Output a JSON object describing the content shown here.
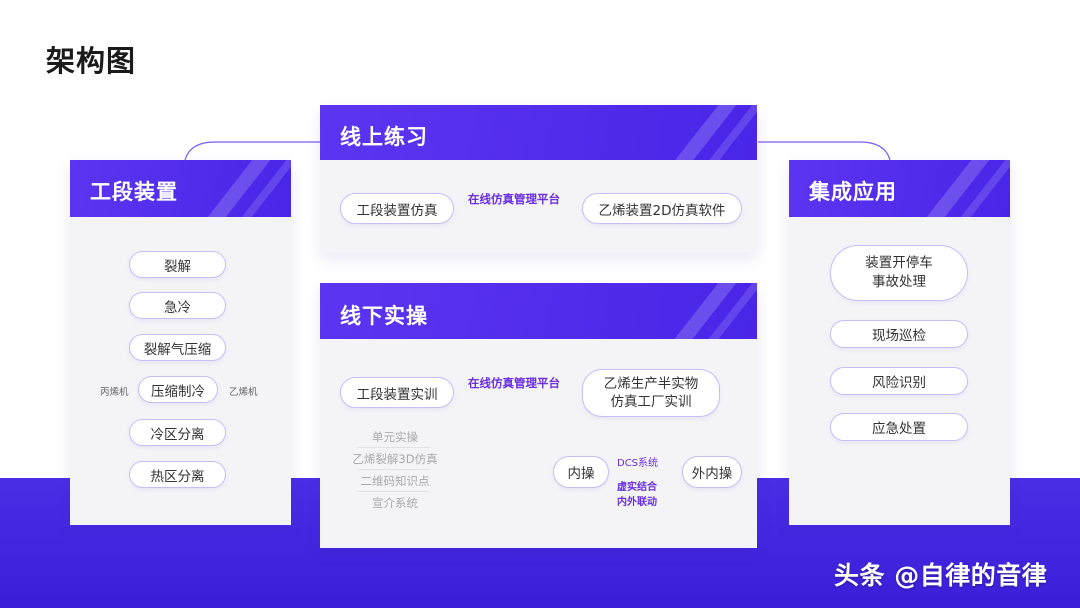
{
  "page": {
    "title": "架构图"
  },
  "colors": {
    "accent": "#5b35f0",
    "band": "#4a2ee6",
    "pill_border": "#c9bdf5",
    "link": "#6a2fe0"
  },
  "left_card": {
    "title": "工段装置",
    "items": [
      "裂解",
      "急冷",
      "裂解气压缩",
      "压缩制冷",
      "冷区分离",
      "热区分离"
    ],
    "side_left": "丙烯机",
    "side_right": "乙烯机"
  },
  "online_card": {
    "title": "线上练习",
    "left_pill": "工段装置仿真",
    "link_label": "在线仿真管理平台",
    "right_pill": "乙烯装置2D仿真软件"
  },
  "offline_card": {
    "title": "线下实操",
    "left_pill": "工段装置实训",
    "link_label": "在线仿真管理平台",
    "right_pill_line1": "乙烯生产半实物",
    "right_pill_line2": "仿真工厂实训",
    "sub_items": [
      "单元实操",
      "乙烯裂解3D仿真",
      "二维码知识点",
      "宣介系统"
    ],
    "inner_pill": "内操",
    "outer_pill": "外内操",
    "dcs_label": "DCS系统",
    "link_line1": "虚实结合",
    "link_line2": "内外联动"
  },
  "right_card": {
    "title": "集成应用",
    "item1_line1": "装置开停车",
    "item1_line2": "事故处理",
    "items": [
      "现场巡检",
      "风险识别",
      "应急处置"
    ]
  },
  "watermark": "头条 @自律的音律"
}
